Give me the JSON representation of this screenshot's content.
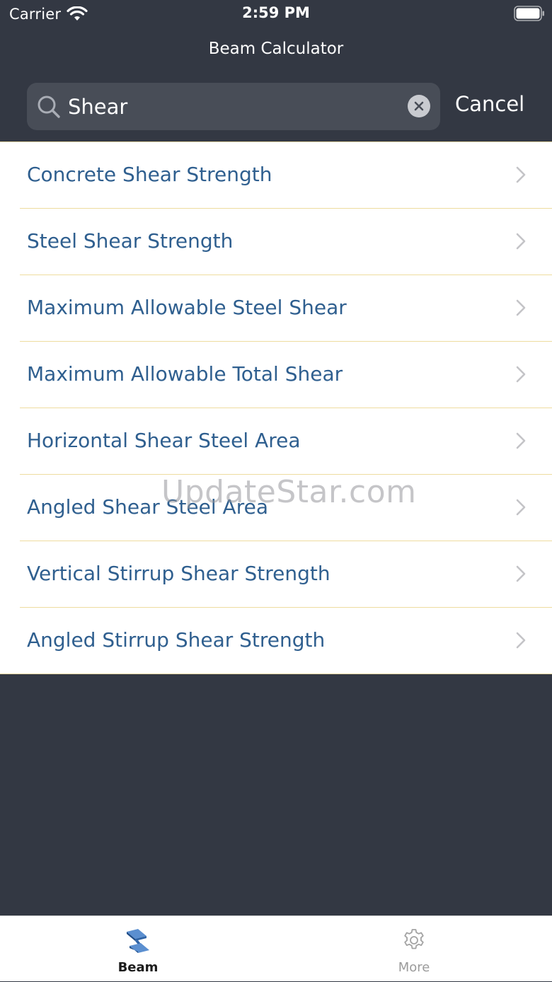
{
  "status_bar": {
    "carrier": "Carrier",
    "time": "2:59 PM"
  },
  "nav": {
    "title": "Beam Calculator"
  },
  "search": {
    "value": "Shear",
    "cancel_label": "Cancel"
  },
  "results": [
    {
      "label": "Concrete Shear Strength"
    },
    {
      "label": "Steel Shear Strength"
    },
    {
      "label": "Maximum Allowable Steel Shear"
    },
    {
      "label": "Maximum Allowable Total Shear"
    },
    {
      "label": "Horizontal Shear Steel Area"
    },
    {
      "label": "Angled Shear Steel Area"
    },
    {
      "label": "Vertical Stirrup Shear Strength"
    },
    {
      "label": "Angled Stirrup Shear Strength"
    }
  ],
  "watermark": "UpdateStar.com",
  "tab_bar": {
    "tabs": [
      {
        "label": "Beam",
        "icon": "beam-icon",
        "selected": true
      },
      {
        "label": "More",
        "icon": "gear-icon",
        "selected": false
      }
    ]
  },
  "colors": {
    "background": "#333843",
    "row_text": "#2f5f8f",
    "separator": "#eedc9f",
    "search_field": "#484d57",
    "beam_icon": "#2e63a6"
  }
}
